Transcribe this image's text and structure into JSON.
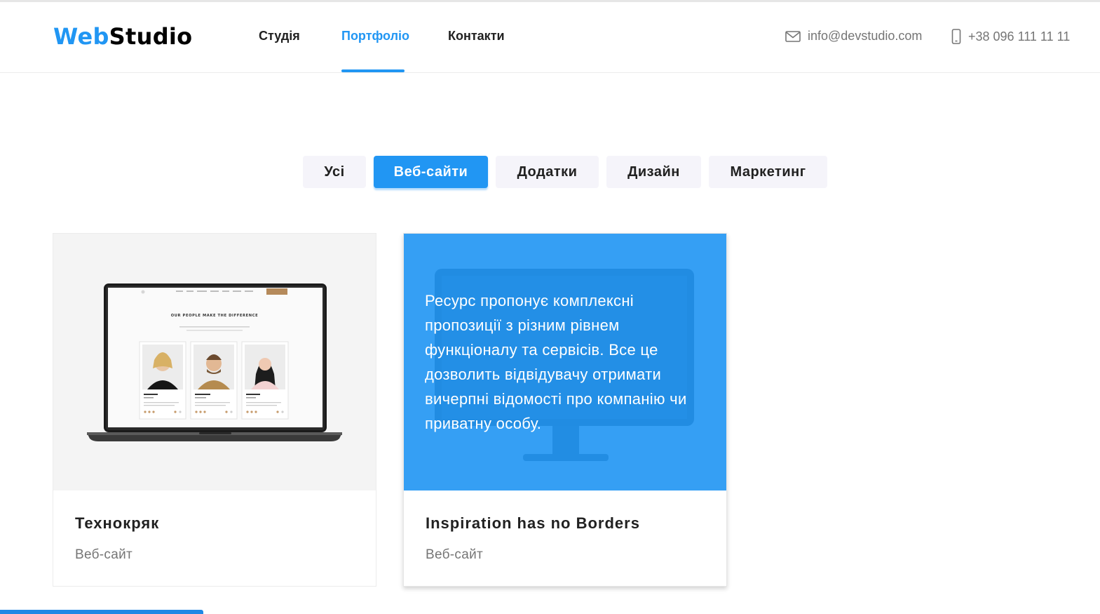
{
  "header": {
    "logo": {
      "part1": "Web",
      "part2": "Studio"
    },
    "nav": [
      {
        "label": "Студія"
      },
      {
        "label": "Портфоліо"
      },
      {
        "label": "Контакти"
      }
    ],
    "email": "info@devstudio.com",
    "phone": "+38 096 111 11 11",
    "active_nav": "Портфоліо"
  },
  "filters": {
    "items": [
      {
        "label": "Усі"
      },
      {
        "label": "Веб-сайти"
      },
      {
        "label": "Додатки"
      },
      {
        "label": "Дизайн"
      },
      {
        "label": "Маркетинг"
      }
    ],
    "active": "Веб-сайти"
  },
  "portfolio": [
    {
      "title": "Технокряк",
      "category": "Веб-сайт",
      "mockup": {
        "heading": "OUR PEOPLE MAKE THE DIFFERENCE"
      }
    },
    {
      "title": "Inspiration has no Borders",
      "category": "Веб-сайт",
      "overlay_text": "Ресурс пропонує комплексні пропозиції з різним рівнем функціоналу та сервісів. Все це дозволить відвідувачу отримати вичерпні відомості про компанію чи приватну особу."
    }
  ],
  "colors": {
    "accent": "#2196f3",
    "text": "#212121",
    "muted": "#757575",
    "filter_bg": "#f5f4fa"
  },
  "icons": {
    "email": "envelope-icon",
    "phone": "smartphone-icon"
  }
}
